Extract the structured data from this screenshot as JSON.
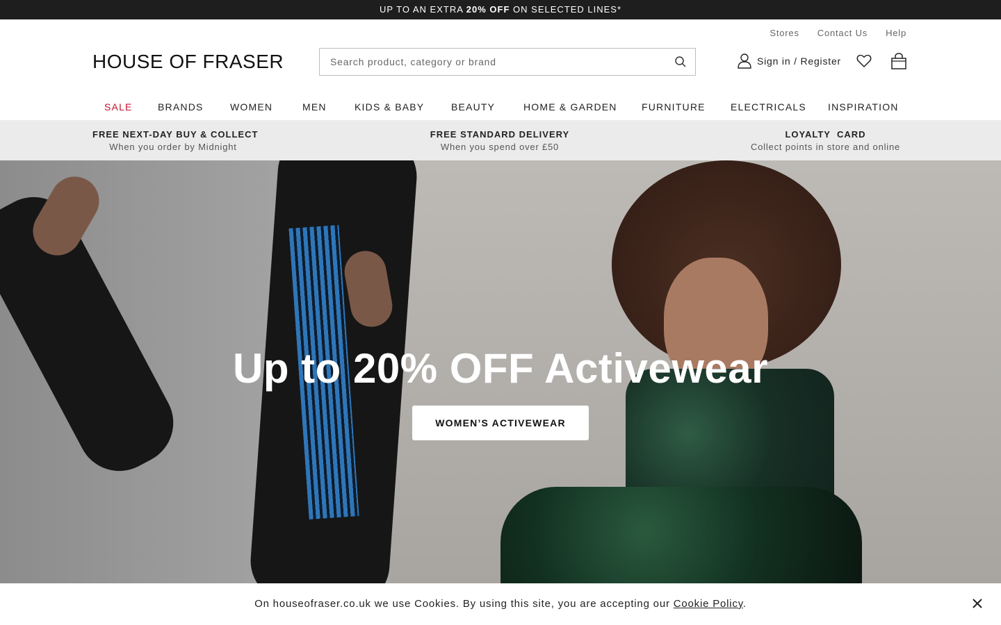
{
  "promo": {
    "prefix": "UP TO AN EXTRA ",
    "highlight": "20% OFF",
    "suffix": " ON SELECTED LINES*"
  },
  "utility_links": [
    "Stores",
    "Contact Us",
    "Help"
  ],
  "logo": "HOUSE OF FRASER",
  "search": {
    "placeholder": "Search product, category or brand",
    "icon": "search-icon"
  },
  "account": {
    "label": "Sign in / Register",
    "icon": "user-icon"
  },
  "wishlist_icon": "heart-icon",
  "bag_icon": "shopping-bag-icon",
  "nav": {
    "items": [
      "SALE",
      "BRANDS",
      "WOMEN",
      "MEN",
      "KIDS & BABY",
      "BEAUTY",
      "HOME & GARDEN",
      "FURNITURE",
      "ELECTRICALS",
      "INSPIRATION"
    ],
    "sale_color": "#c8102e"
  },
  "usps": [
    {
      "title": "FREE NEXT-DAY BUY & COLLECT",
      "subtitle": "When you order by Midnight"
    },
    {
      "title": "FREE STANDARD DELIVERY",
      "subtitle": "When you spend over £50"
    },
    {
      "title": "LOYALTY  CARD",
      "subtitle": "Collect points in store and online"
    }
  ],
  "hero": {
    "title": "Up to 20% OFF Activewear",
    "cta": "WOMEN’S ACTIVEWEAR"
  },
  "cookie": {
    "prefix": "On houseofraser.co.uk we use Cookies. By using this site, you are accepting our ",
    "link": "Cookie Policy",
    "suffix": ".",
    "close_icon": "close-icon"
  }
}
